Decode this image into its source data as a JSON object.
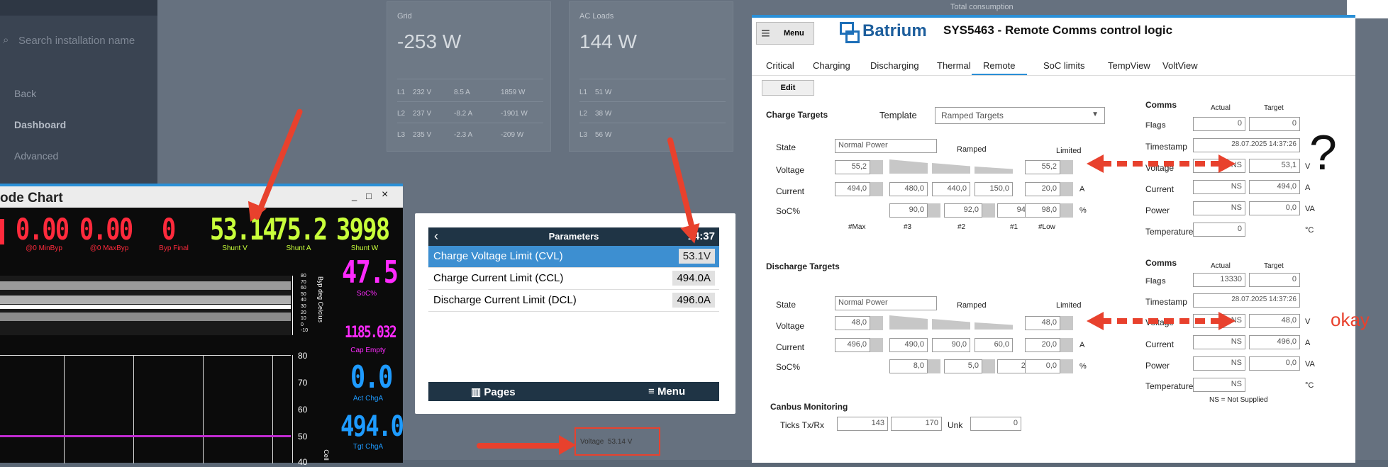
{
  "vrm": {
    "search_placeholder": "Search installation name",
    "nav": [
      "Back",
      "Dashboard",
      "Advanced"
    ],
    "grid": {
      "title": "Grid",
      "value": "-253 W",
      "rows": [
        [
          "L1",
          "232 V",
          "8.5 A",
          "1859 W"
        ],
        [
          "L2",
          "237 V",
          "-8.2 A",
          "-1901 W"
        ],
        [
          "L3",
          "235 V",
          "-2.3 A",
          "-209 W"
        ]
      ]
    },
    "ac_loads": {
      "title": "AC Loads",
      "value": "144 W",
      "rows": [
        [
          "L1",
          "51 W"
        ],
        [
          "L2",
          "38 W"
        ],
        [
          "L3",
          "56 W"
        ]
      ]
    },
    "top_right": "Total consumption",
    "voltage_box": "Voltage  53.14 V"
  },
  "chart_window": {
    "title": "ode Chart",
    "controls": [
      "_",
      "□",
      "×"
    ],
    "readouts": [
      {
        "value": "0.00",
        "label": "@0 MinByp",
        "color": "#ff2a3c"
      },
      {
        "value": "0.00",
        "label": "@0 MaxByp",
        "color": "#ff2a3c"
      },
      {
        "value": "0",
        "label": "Byp Final",
        "color": "#ff2a3c"
      },
      {
        "value": "53.14",
        "label": "Shunt V",
        "color": "#c8ff3a"
      },
      {
        "value": "75.2",
        "label": "Shunt A",
        "color": "#c8ff3a"
      },
      {
        "value": "3998",
        "label": "Shunt W",
        "color": "#c8ff3a"
      }
    ],
    "side": [
      {
        "value": "47.5",
        "label": "SoC%",
        "color": "#ff2aff"
      },
      {
        "value": "1185.032",
        "label": "Cap Empty",
        "color": "#ff2aff"
      },
      {
        "value": "0.0",
        "label": "Act ChgA",
        "color": "#1e9bff"
      },
      {
        "value": "494.0",
        "label": "Tgt ChgA",
        "color": "#1e9bff"
      }
    ],
    "axis_top": [
      "80",
      "70",
      "60",
      "50",
      "40",
      "30",
      "20",
      "10",
      "0",
      "-10"
    ],
    "axis_top_label": "Byp deg Celcius",
    "axis_bottom": [
      "80",
      "70",
      "60",
      "50",
      "40"
    ],
    "axis_bottom_label": "Cell"
  },
  "victron": {
    "title": "Parameters",
    "time": "14:37",
    "rows": [
      {
        "name": "Charge Voltage Limit (CVL)",
        "value": "53.1V",
        "selected": true
      },
      {
        "name": "Charge Current Limit (CCL)",
        "value": "494.0A",
        "selected": false
      },
      {
        "name": "Discharge Current Limit (DCL)",
        "value": "496.0A",
        "selected": false
      }
    ],
    "footer_left": "Pages",
    "footer_right": "Menu"
  },
  "batrium": {
    "menu_label": "Menu",
    "brand": "Batrium",
    "heading": "SYS5463 - Remote Comms control logic",
    "tabs": [
      "Critical",
      "Charging",
      "Discharging",
      "Thermal",
      "Remote",
      "SoC limits",
      "TempView",
      "VoltView"
    ],
    "active_tab": "Remote",
    "edit_label": "Edit",
    "charge": {
      "title": "Charge Targets",
      "template_label": "Template",
      "template_value": "Ramped Targets",
      "state_label": "State",
      "state_value": "Normal Power",
      "ramped_label": "Ramped",
      "limited_label": "Limited",
      "voltage_label": "Voltage",
      "current_label": "Current",
      "soc_label": "SoC%",
      "voltage": {
        "max": "55,2",
        "limited": "55,2"
      },
      "current": [
        "494,0",
        "480,0",
        "440,0",
        "150,0",
        "20,0"
      ],
      "soc": [
        "90,0",
        "92,0",
        "94,0",
        "98,0"
      ],
      "unit_a": "A",
      "unit_pct": "%",
      "cols": [
        "#Max",
        "#3",
        "#2",
        "#1",
        "#Low"
      ]
    },
    "discharge": {
      "title": "Discharge Targets",
      "state_label": "State",
      "state_value": "Normal Power",
      "ramped_label": "Ramped",
      "limited_label": "Limited",
      "voltage_label": "Voltage",
      "current_label": "Current",
      "soc_label": "SoC%",
      "voltage": {
        "max": "48,0",
        "limited": "48,0"
      },
      "current": [
        "496,0",
        "490,0",
        "90,0",
        "60,0",
        "20,0"
      ],
      "soc": [
        "8,0",
        "5,0",
        "2,0",
        "0,0"
      ],
      "unit_a": "A",
      "unit_pct": "%"
    },
    "comms1": {
      "title": "Comms",
      "actual": "Actual",
      "target": "Target",
      "rows": [
        {
          "label": "Flags",
          "actual": "0",
          "target": "0",
          "unit": ""
        },
        {
          "label": "Timestamp",
          "actual": "",
          "target": "28.07.2025 14:37:26",
          "unit": ""
        },
        {
          "label": "Voltage",
          "actual": "NS",
          "target": "53,1",
          "unit": "V"
        },
        {
          "label": "Current",
          "actual": "NS",
          "target": "494,0",
          "unit": "A"
        },
        {
          "label": "Power",
          "actual": "NS",
          "target": "0,0",
          "unit": "VA"
        },
        {
          "label": "Temperature",
          "actual": "0",
          "target": "",
          "unit": "°C"
        }
      ]
    },
    "comms2": {
      "title": "Comms",
      "actual": "Actual",
      "target": "Target",
      "rows": [
        {
          "label": "Flags",
          "actual": "13330",
          "target": "0",
          "unit": ""
        },
        {
          "label": "Timestamp",
          "actual": "",
          "target": "28.07.2025 14:37:26",
          "unit": ""
        },
        {
          "label": "Voltage",
          "actual": "NS",
          "target": "48,0",
          "unit": "V"
        },
        {
          "label": "Current",
          "actual": "NS",
          "target": "496,0",
          "unit": "A"
        },
        {
          "label": "Power",
          "actual": "NS",
          "target": "0,0",
          "unit": "VA"
        },
        {
          "label": "Temperature",
          "actual": "NS",
          "target": "",
          "unit": "°C"
        }
      ],
      "note": "NS = Not Supplied"
    },
    "canbus": {
      "title": "Canbus Monitoring",
      "label": "Ticks Tx/Rx",
      "tx": "143",
      "rx": "170",
      "unk_label": "Unk",
      "unk": "0"
    }
  },
  "annotations": {
    "question": "?",
    "okay": "okay"
  },
  "colors": {
    "accent": "#2a8fd6",
    "arrow": "#e8412d",
    "victron_header": "#1f3445",
    "victron_selected": "#3d8fd1"
  }
}
